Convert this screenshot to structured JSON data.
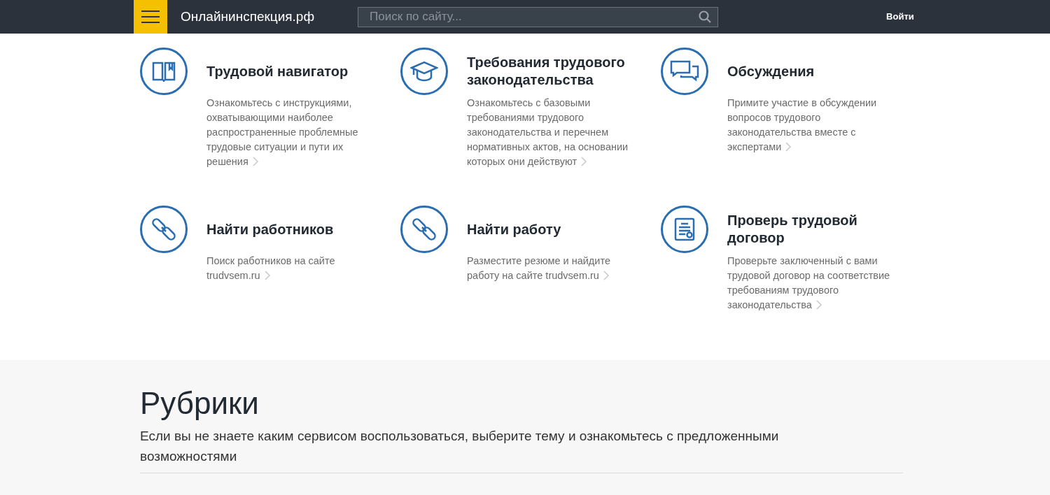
{
  "header": {
    "logo": "Онлайнинспекция.рф",
    "search": {
      "placeholder": "Поиск по сайту..."
    },
    "login": "Войти"
  },
  "services": [
    {
      "title": "Трудовой навигатор",
      "description": "Ознакомьтесь с инструкциями, охватывающими наиболее распространенные проблемные трудовые ситуации и пути их решения"
    },
    {
      "title": "Требования трудового законодательства",
      "description": "Ознакомьтесь с базовыми требованиями трудового законодательства и перечнем нормативных актов, на основании которых они действуют"
    },
    {
      "title": "Обсуждения",
      "description": "Примите участие в обсуждении вопросов трудового законодательства вместе с экспертами"
    },
    {
      "title": "Найти работников",
      "description": "Поиск работников на сайте trudvsem.ru"
    },
    {
      "title": "Найти работу",
      "description": "Разместите резюме и найдите работу на сайте trudvsem.ru"
    },
    {
      "title": "Проверь трудовой договор",
      "description": "Проверьте заключенный с вами трудовой договор на соответствие требованиям трудового законодательства"
    }
  ],
  "rubrics": {
    "heading": "Рубрики",
    "text": "Если вы не знаете каким сервисом воспользоваться, выберите тему и ознакомьтесь с предложенными возможностями"
  }
}
